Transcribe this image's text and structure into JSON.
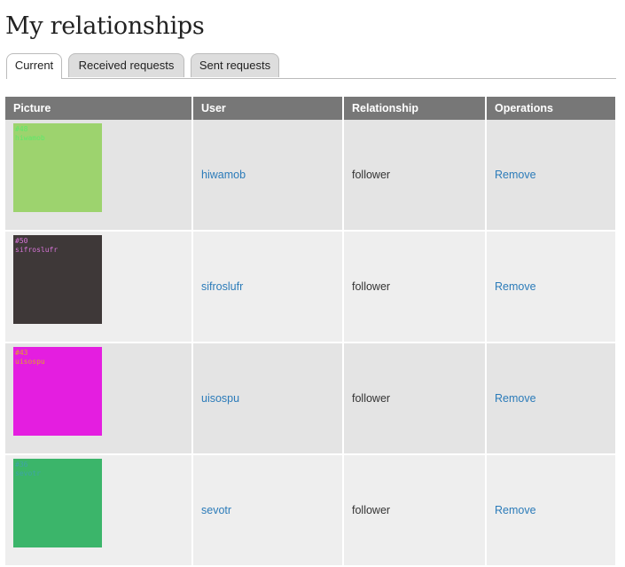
{
  "page": {
    "title": "My relationships"
  },
  "tabs": [
    {
      "label": "Current",
      "active": true
    },
    {
      "label": "Received requests",
      "active": false
    },
    {
      "label": "Sent requests",
      "active": false
    }
  ],
  "table": {
    "headers": [
      "Picture",
      "User",
      "Relationship",
      "Operations"
    ],
    "rows": [
      {
        "picture": {
          "number": "#48",
          "name": "hiwamob",
          "bg": "#9dd36e",
          "fg": "#5fe86a"
        },
        "user": "hiwamob",
        "relationship": "follower",
        "operation": "Remove"
      },
      {
        "picture": {
          "number": "#50",
          "name": "sifroslufr",
          "bg": "#3e3838",
          "fg": "#d774d8"
        },
        "user": "sifroslufr",
        "relationship": "follower",
        "operation": "Remove"
      },
      {
        "picture": {
          "number": "#43",
          "name": "uisospu",
          "bg": "#e41ee0",
          "fg": "#e2a02a"
        },
        "user": "uisospu",
        "relationship": "follower",
        "operation": "Remove"
      },
      {
        "picture": {
          "number": "#36",
          "name": "sevotr",
          "bg": "#3bb56a",
          "fg": "#3fa4a6"
        },
        "user": "sevotr",
        "relationship": "follower",
        "operation": "Remove"
      }
    ]
  },
  "colors": {
    "header_bg": "#777777",
    "row_odd": "#e4e4e4",
    "row_even": "#eeeeee",
    "link": "#2b7bb9"
  }
}
